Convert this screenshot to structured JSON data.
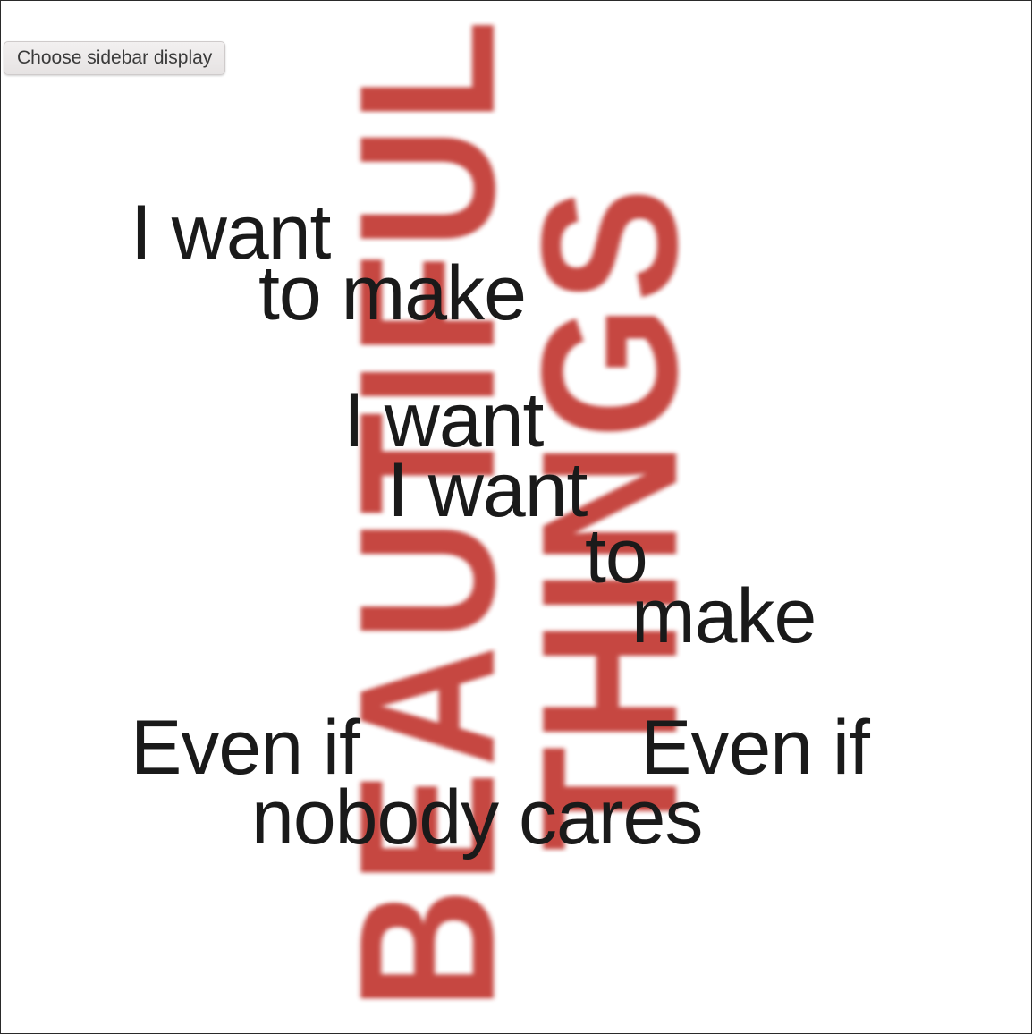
{
  "toolbar": {
    "sidebar_button_label": "Choose sidebar display"
  },
  "artwork": {
    "vertical_words": [
      "BEAUTIFUL",
      "THINGS"
    ],
    "lines": [
      "I want",
      "to make",
      "I want",
      "I want",
      "to",
      "make",
      "Even if",
      "Even if",
      "nobody cares"
    ]
  },
  "colors": {
    "vertical_text": "#c4403a",
    "poem_text": "#1a1a1a",
    "frame_border": "#2a2a2a",
    "background": "#ffffff"
  }
}
